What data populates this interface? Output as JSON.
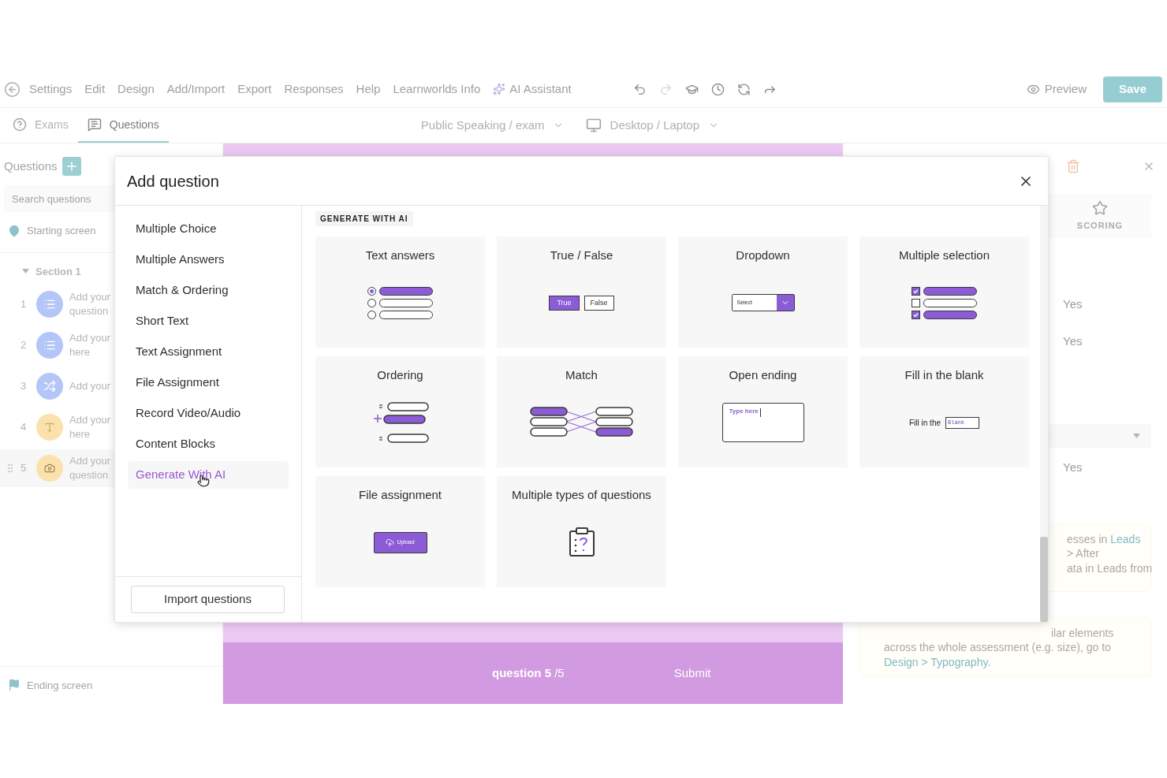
{
  "menu": {
    "items": [
      "Settings",
      "Edit",
      "Design",
      "Add/Import",
      "Export",
      "Responses",
      "Help",
      "Learnworlds Info"
    ],
    "ai_assistant": "AI Assistant",
    "tools": [
      {
        "kind": "undo",
        "disabled": false
      },
      {
        "kind": "redo",
        "disabled": true
      },
      {
        "kind": "cap",
        "disabled": false
      },
      {
        "kind": "history",
        "disabled": false
      },
      {
        "kind": "refresh",
        "disabled": false
      },
      {
        "kind": "share",
        "disabled": false
      }
    ],
    "preview": "Preview",
    "save": "Save"
  },
  "tabs": [
    {
      "label": "Exams",
      "kind": "help",
      "selected": false
    },
    {
      "label": "Questions",
      "kind": "chat",
      "selected": true
    }
  ],
  "exam_picker": "Public Speaking / exam",
  "device_picker": "Desktop / Laptop",
  "sidebar": {
    "title": "Questions",
    "search": {
      "placeholder": "Search questions"
    },
    "starting": "Starting screen",
    "section": {
      "label": "Section 1",
      "expanded": true
    },
    "items": [
      {
        "number": "1",
        "text": "Add your question",
        "kind": "list",
        "selected": false
      },
      {
        "number": "2",
        "text": "Add your here",
        "kind": "list",
        "selected": false
      },
      {
        "number": "3",
        "text": "Add your",
        "kind": "shuffle",
        "selected": false
      },
      {
        "number": "4",
        "text": "Add your here",
        "kind": "text",
        "selected": false
      },
      {
        "number": "5",
        "text": "Add your question",
        "kind": "camera",
        "selected": true
      }
    ],
    "ending": "Ending screen"
  },
  "canvas": {
    "counter": "**question 5** /5",
    "submit": "Submit"
  },
  "right_panel": {
    "tab": "SCORING",
    "toggles": [
      "Yes",
      "Yes"
    ],
    "toggle_after": "Yes",
    "info": [
      {
        "lines": [
          {
            "text": "esses in ",
            "link": "Leads"
          },
          {
            "text": "> After"
          },
          {
            "text": "ata in Leads from"
          }
        ]
      },
      {
        "lines": [
          {
            "text": "ilar elements"
          },
          {
            "text": "across the whole assessment (e.g. size), go to"
          },
          {
            "link": "Design > Typography."
          }
        ]
      }
    ]
  },
  "modal": {
    "title": "Add question",
    "types": [
      {
        "label": "Multiple Choice",
        "selected": false
      },
      {
        "label": "Multiple Answers",
        "selected": false
      },
      {
        "label": "Match & Ordering",
        "selected": false
      },
      {
        "label": "Short Text",
        "selected": false
      },
      {
        "label": "Text Assignment",
        "selected": false
      },
      {
        "label": "File Assignment",
        "selected": false
      },
      {
        "label": "Record Video/Audio",
        "selected": false
      },
      {
        "label": "Content Blocks",
        "selected": false
      },
      {
        "label": "Generate With AI",
        "selected": true
      }
    ],
    "import": "Import questions",
    "tag": "GENERATE WITH AI",
    "cards": [
      {
        "title": "Text answers",
        "kind": "radio"
      },
      {
        "title": "True / False",
        "kind": "true-false",
        "labels": [
          "True",
          "False"
        ]
      },
      {
        "title": "Dropdown",
        "kind": "dropdown",
        "labels": [
          "Select"
        ]
      },
      {
        "title": "Multiple selection",
        "kind": "checkbox"
      },
      {
        "title": "Ordering",
        "kind": "ordering"
      },
      {
        "title": "Match",
        "kind": "match"
      },
      {
        "title": "Open ending",
        "kind": "open",
        "labels": [
          "Type here"
        ]
      },
      {
        "title": "Fill in the blank",
        "kind": "blank",
        "labels": [
          "Fill in the",
          "Blank"
        ]
      },
      {
        "title": "File assignment",
        "kind": "upload",
        "labels": [
          "Upload"
        ]
      },
      {
        "title": "Multiple types of questions",
        "kind": "clipboard"
      }
    ]
  }
}
